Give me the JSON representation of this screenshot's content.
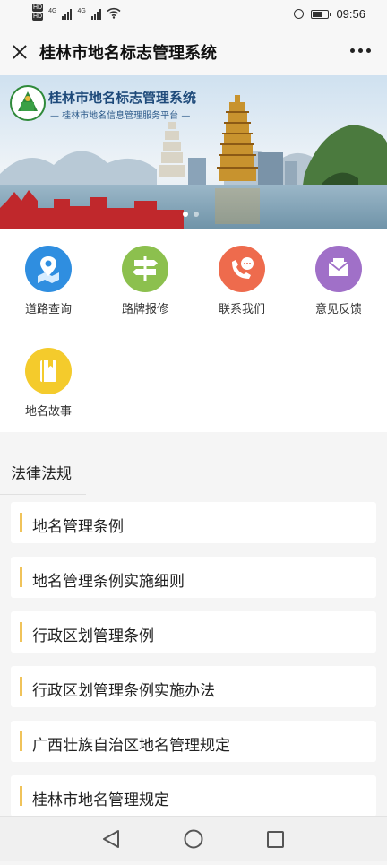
{
  "status_bar": {
    "hd1": "HD",
    "hd2": "HD",
    "net1": "4G",
    "net2": "4G",
    "time": "09:56"
  },
  "app": {
    "title": "桂林市地名标志管理系统"
  },
  "banner": {
    "title": "桂林市地名标志管理系统",
    "subtitle": "— 桂林市地名信息管理服务平台 —"
  },
  "grid": {
    "items": [
      {
        "label": "道路查询",
        "icon": "map-pin-icon",
        "color": "#2f8ee0"
      },
      {
        "label": "路牌报修",
        "icon": "signpost-icon",
        "color": "#8cc04e"
      },
      {
        "label": "联系我们",
        "icon": "phone-chat-icon",
        "color": "#ee6b4d"
      },
      {
        "label": "意见反馈",
        "icon": "envelope-icon",
        "color": "#a070c8"
      },
      {
        "label": "地名故事",
        "icon": "book-icon",
        "color": "#f4cb2c"
      }
    ]
  },
  "laws": {
    "title": "法律法规",
    "items": [
      "地名管理条例",
      "地名管理条例实施细则",
      "行政区划管理条例",
      "行政区划管理条例实施办法",
      "广西壮族自治区地名管理规定",
      "桂林市地名管理规定"
    ]
  },
  "colors": {
    "accent_bar": "#f0c35a",
    "banner_title": "#1e4a7a"
  }
}
